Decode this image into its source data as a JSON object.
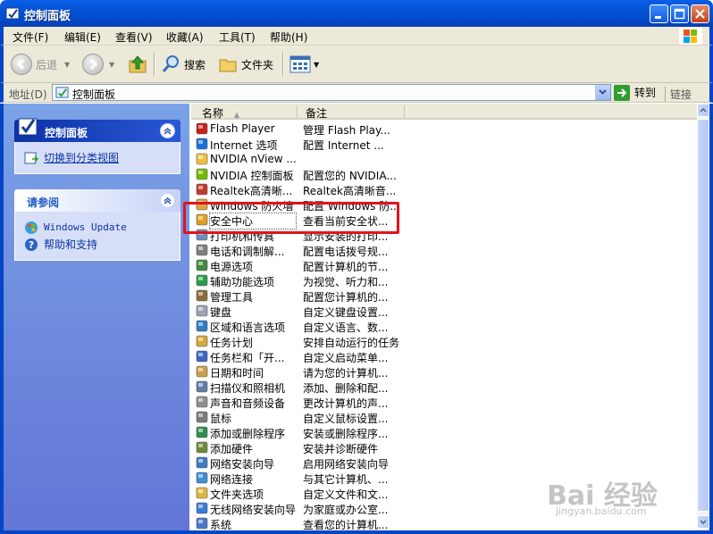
{
  "window": {
    "title": "控制面板"
  },
  "menu": [
    "文件(F)",
    "编辑(E)",
    "查看(V)",
    "收藏(A)",
    "工具(T)",
    "帮助(H)"
  ],
  "toolbar": {
    "back": "后退",
    "search": "搜索",
    "folders": "文件夹"
  },
  "address": {
    "label": "地址(D)",
    "value": "控制面板",
    "go": "转到",
    "links": "链接"
  },
  "left": {
    "panel_title": "控制面板",
    "switch_link": "切换到分类视图",
    "see_also_title": "请参阅",
    "see_also": [
      "Windows Update",
      "帮助和支持"
    ]
  },
  "columns": {
    "name": "名称",
    "comment": "备注"
  },
  "items": [
    {
      "name": "Flash Player",
      "comment": "管理 Flash Play..."
    },
    {
      "name": "Internet 选项",
      "comment": "配置 Internet ..."
    },
    {
      "name": "NVIDIA nView ...",
      "comment": ""
    },
    {
      "name": "NVIDIA 控制面板",
      "comment": "配置您的 NVIDIA..."
    },
    {
      "name": "Realtek高清晰...",
      "comment": "Realtek高清晰音..."
    },
    {
      "name": "Windows 防火墙",
      "comment": "配置 Windows 防..."
    },
    {
      "name": "安全中心",
      "comment": "查看当前安全状..."
    },
    {
      "name": "打印机和传真",
      "comment": "显示安装的打印..."
    },
    {
      "name": "电话和调制解...",
      "comment": "配置电话拨号规..."
    },
    {
      "name": "电源选项",
      "comment": "配置计算机的节..."
    },
    {
      "name": "辅助功能选项",
      "comment": "为视觉、听力和..."
    },
    {
      "name": "管理工具",
      "comment": "配置您计算机的..."
    },
    {
      "name": "键盘",
      "comment": "自定义键盘设置..."
    },
    {
      "name": "区域和语言选项",
      "comment": "自定义语言、数..."
    },
    {
      "name": "任务计划",
      "comment": "安排自动运行的任务"
    },
    {
      "name": "任务栏和「开...",
      "comment": "自定义启动菜单..."
    },
    {
      "name": "日期和时间",
      "comment": "请为您的计算机..."
    },
    {
      "name": "扫描仪和照相机",
      "comment": "添加、删除和配..."
    },
    {
      "name": "声音和音频设备",
      "comment": "更改计算机的声..."
    },
    {
      "name": "鼠标",
      "comment": "自定义鼠标设置..."
    },
    {
      "name": "添加或删除程序",
      "comment": "安装或删除程序..."
    },
    {
      "name": "添加硬件",
      "comment": "安装并诊断硬件"
    },
    {
      "name": "网络安装向导",
      "comment": "启用网络安装向导"
    },
    {
      "name": "网络连接",
      "comment": "与其它计算机、..."
    },
    {
      "name": "文件夹选项",
      "comment": "自定义文件和文..."
    },
    {
      "name": "无线网络安装向导",
      "comment": "为家庭或办公室..."
    },
    {
      "name": "系统",
      "comment": "查看您的计算机..."
    }
  ],
  "icon_colors": [
    "#c8201c",
    "#1a6fd6",
    "#f0c040",
    "#76b900",
    "#c0392b",
    "#d9a441",
    "#e0a020",
    "#6a8fc0",
    "#7f7f7f",
    "#3c8c3c",
    "#2a9d4a",
    "#8a6d3b",
    "#9aa5b1",
    "#2f7dc6",
    "#d4a93a",
    "#3a66c4",
    "#c9a24a",
    "#5e7ea8",
    "#8f8f8f",
    "#7a7a7a",
    "#2d8f4e",
    "#6f8a3a",
    "#3d7ac4",
    "#3c8fd4",
    "#e2b740",
    "#3a7ad8",
    "#4a78c8"
  ],
  "watermark": {
    "brand": "Bai  经验",
    "url": "jingyan.baidu.com"
  }
}
